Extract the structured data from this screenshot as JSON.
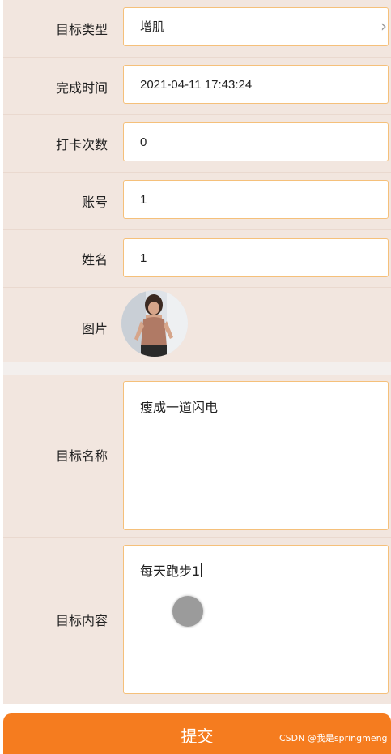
{
  "form": {
    "goal_type": {
      "label": "目标类型",
      "value": "增肌"
    },
    "finish_time": {
      "label": "完成时间",
      "value": "2021-04-11 17:43:24"
    },
    "checkin_count": {
      "label": "打卡次数",
      "value": "0"
    },
    "account": {
      "label": "账号",
      "value": "1"
    },
    "name": {
      "label": "姓名",
      "value": "1"
    },
    "picture": {
      "label": "图片"
    },
    "goal_name": {
      "label": "目标名称",
      "value": "瘦成一道闪电"
    },
    "goal_content": {
      "label": "目标内容",
      "value": "每天跑步1"
    }
  },
  "submit": {
    "label": "提交"
  },
  "watermark": "CSDN @我是springmeng",
  "icons": {
    "chevron": "chevron-right-icon"
  },
  "colors": {
    "accent": "#f57c1f",
    "field_border": "#f5c07a",
    "background": "#f2e6df"
  }
}
